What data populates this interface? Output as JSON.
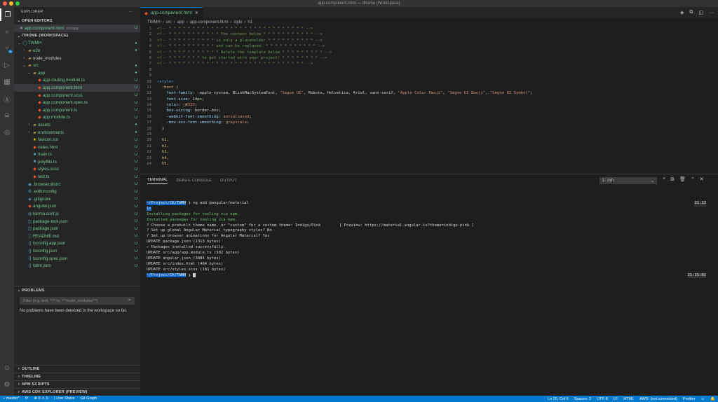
{
  "window": {
    "title": "app.component.html — ithome (Workspace)"
  },
  "activity_bar": {
    "items": [
      {
        "icon": "files-icon",
        "glyph": "❐"
      },
      {
        "icon": "search-icon",
        "glyph": "⌕"
      },
      {
        "icon": "source-control-icon",
        "glyph": "⑂",
        "badge": "31"
      },
      {
        "icon": "run-debug-icon",
        "glyph": "▷"
      },
      {
        "icon": "extensions-icon",
        "glyph": "▦"
      },
      {
        "icon": "angular-icon",
        "glyph": "Ⓐ"
      },
      {
        "icon": "aws-icon",
        "glyph": "≋"
      },
      {
        "icon": "remote-explorer-icon",
        "glyph": "◎"
      }
    ],
    "bottom": [
      {
        "icon": "accounts-icon",
        "glyph": "☺"
      },
      {
        "icon": "settings-gear-icon",
        "glyph": "⚙"
      }
    ]
  },
  "sidebar": {
    "title": "EXPLORER",
    "more": "···",
    "open_editors": {
      "label": "OPEN EDITORS",
      "items": [
        {
          "close": "✕",
          "name": "app.component.html",
          "path": "src/app",
          "decoration": "U"
        }
      ]
    },
    "workspace": {
      "label": "ITHOME (WORKSPACE)",
      "tree": [
        {
          "depth": 0,
          "twist": "⌄",
          "icon": "◯",
          "color": "#73c991",
          "name": "TWMH",
          "decoration": "●"
        },
        {
          "depth": 1,
          "twist": "›",
          "icon": "▰",
          "color": "#73c991",
          "name": "e2e",
          "decoration": "●"
        },
        {
          "depth": 1,
          "twist": "›",
          "icon": "▰",
          "color": "#cccccc",
          "name": "node_modules",
          "decoration": ""
        },
        {
          "depth": 1,
          "twist": "⌄",
          "icon": "▰",
          "color": "#73c991",
          "name": "src",
          "decoration": "●"
        },
        {
          "depth": 2,
          "twist": "⌄",
          "icon": "▰",
          "color": "#73c991",
          "name": "app",
          "decoration": "●"
        },
        {
          "depth": 3,
          "twist": "",
          "icon": "◆",
          "color": "#73c991",
          "name": "app-routing.module.ts",
          "decoration": "U"
        },
        {
          "depth": 3,
          "twist": "",
          "icon": "◆",
          "color": "#73c991",
          "name": "app.component.html",
          "decoration": "U",
          "selected": true
        },
        {
          "depth": 3,
          "twist": "",
          "icon": "◆",
          "color": "#73c991",
          "name": "app.component.scss",
          "decoration": "U"
        },
        {
          "depth": 3,
          "twist": "",
          "icon": "◆",
          "color": "#73c991",
          "name": "app.component.spec.ts",
          "decoration": "U"
        },
        {
          "depth": 3,
          "twist": "",
          "icon": "◆",
          "color": "#73c991",
          "name": "app.component.ts",
          "decoration": "U"
        },
        {
          "depth": 3,
          "twist": "",
          "icon": "◆",
          "color": "#73c991",
          "name": "app.module.ts",
          "decoration": "U"
        },
        {
          "depth": 2,
          "twist": "›",
          "icon": "▰",
          "color": "#73c991",
          "name": "assets",
          "decoration": "●"
        },
        {
          "depth": 2,
          "twist": "›",
          "icon": "▰",
          "color": "#73c991",
          "name": "environments",
          "decoration": "●"
        },
        {
          "depth": 2,
          "twist": "",
          "icon": "★",
          "color": "#73c991",
          "name": "favicon.ico",
          "decoration": "U"
        },
        {
          "depth": 2,
          "twist": "",
          "icon": "◆",
          "color": "#73c991",
          "name": "index.html",
          "decoration": "U"
        },
        {
          "depth": 2,
          "twist": "",
          "icon": "■",
          "color": "#73c991",
          "name": "main.ts",
          "decoration": "U"
        },
        {
          "depth": 2,
          "twist": "",
          "icon": "■",
          "color": "#73c991",
          "name": "polyfills.ts",
          "decoration": "U"
        },
        {
          "depth": 2,
          "twist": "",
          "icon": "◆",
          "color": "#73c991",
          "name": "styles.scss",
          "decoration": "U"
        },
        {
          "depth": 2,
          "twist": "",
          "icon": "◆",
          "color": "#73c991",
          "name": "test.ts",
          "decoration": "U"
        },
        {
          "depth": 1,
          "twist": "",
          "icon": "◉",
          "color": "#73c991",
          "name": ".browserslistrc",
          "decoration": "U"
        },
        {
          "depth": 1,
          "twist": "",
          "icon": "⚙",
          "color": "#73c991",
          "name": ".editorconfig",
          "decoration": "U"
        },
        {
          "depth": 1,
          "twist": "",
          "icon": "◈",
          "color": "#73c991",
          "name": ".gitignore",
          "decoration": "U"
        },
        {
          "depth": 1,
          "twist": "",
          "icon": "◆",
          "color": "#73c991",
          "name": "angular.json",
          "decoration": "U"
        },
        {
          "depth": 1,
          "twist": "",
          "icon": "◍",
          "color": "#73c991",
          "name": "karma.conf.js",
          "decoration": "U"
        },
        {
          "depth": 1,
          "twist": "",
          "icon": "◫",
          "color": "#73c991",
          "name": "package-lock.json",
          "decoration": "U"
        },
        {
          "depth": 1,
          "twist": "",
          "icon": "◫",
          "color": "#73c991",
          "name": "package.json",
          "decoration": "U"
        },
        {
          "depth": 1,
          "twist": "",
          "icon": "ⓘ",
          "color": "#73c991",
          "name": "README.md",
          "decoration": "U"
        },
        {
          "depth": 1,
          "twist": "",
          "icon": "{}",
          "color": "#73c991",
          "name": "tsconfig.app.json",
          "decoration": "U"
        },
        {
          "depth": 1,
          "twist": "",
          "icon": "{}",
          "color": "#73c991",
          "name": "tsconfig.json",
          "decoration": "U"
        },
        {
          "depth": 1,
          "twist": "",
          "icon": "{}",
          "color": "#73c991",
          "name": "tsconfig.spec.json",
          "decoration": "U"
        },
        {
          "depth": 1,
          "twist": "",
          "icon": "{}",
          "color": "#73c991",
          "name": "tslint.json",
          "decoration": "U"
        }
      ]
    },
    "problems": {
      "label": "PROBLEMS",
      "filter_placeholder": "Filter (e.g. text, **/*.ts, !**/node_modules/**)",
      "message": "No problems have been detected in the workspace so far."
    },
    "bottom_sections": [
      "OUTLINE",
      "TIMELINE",
      "NPM SCRIPTS",
      "AWS CDK EXPLORER (PREVIEW)"
    ]
  },
  "editor": {
    "tab": {
      "label": "app.component.html",
      "close": "✕"
    },
    "breadcrumb": [
      "TWMH",
      "src",
      "app",
      "app.component.html",
      "style",
      "h1"
    ],
    "lines": [
      {
        "n": "1",
        "parts": [
          {
            "t": "<!-- * * * * * * * * * * * * * * * * * * * * * * * * * * * * * -->",
            "c": "#6a9955"
          }
        ]
      },
      {
        "n": "2",
        "parts": [
          {
            "t": "<!-- * * * * * * * * * * * The content below * * * * * * * * * * * -->",
            "c": "#6a9955"
          }
        ]
      },
      {
        "n": "3",
        "parts": [
          {
            "t": "<!-- * * * * * * * * * * is only a placeholder * * * * * * * * * * -->",
            "c": "#6a9955"
          }
        ]
      },
      {
        "n": "4",
        "parts": [
          {
            "t": "<!-- * * * * * * * * * * and can be replaced. * * * * * * * * * * * -->",
            "c": "#6a9955"
          }
        ]
      },
      {
        "n": "5",
        "parts": [
          {
            "t": "<!-- * * * * * * * * * * * Delete the template below * * * * * * * * * -->",
            "c": "#6a9955"
          }
        ]
      },
      {
        "n": "6",
        "parts": [
          {
            "t": "<!-- * * * * * * * to get started with your project! * * * * * * * * -->",
            "c": "#6a9955"
          }
        ]
      },
      {
        "n": "7",
        "parts": [
          {
            "t": "<!-- * * * * * * * * * * * * * * * * * * * * * * * * * * * * * -->",
            "c": "#6a9955"
          }
        ]
      },
      {
        "n": "8",
        "parts": []
      },
      {
        "n": "9",
        "parts": []
      },
      {
        "n": "10",
        "parts": [
          {
            "t": "<style>",
            "c": "#569cd6"
          }
        ]
      },
      {
        "n": "11",
        "parts": [
          {
            "t": "  :host {",
            "c": "#d7ba7d"
          }
        ]
      },
      {
        "n": "12",
        "parts": [
          {
            "t": "    font-family",
            "c": "#9cdcfe"
          },
          {
            "t": ": -apple-system, BlinkMacSystemFont, ",
            "c": "#d4d4d4"
          },
          {
            "t": "\"Segoe UI\"",
            "c": "#ce9178"
          },
          {
            "t": ", Roboto, Helvetica, Arial, sans-serif, ",
            "c": "#d4d4d4"
          },
          {
            "t": "\"Apple Color Emoji\"",
            "c": "#ce9178"
          },
          {
            "t": ", ",
            "c": "#d4d4d4"
          },
          {
            "t": "\"Segoe UI Emoji\"",
            "c": "#ce9178"
          },
          {
            "t": ", ",
            "c": "#d4d4d4"
          },
          {
            "t": "\"Segoe UI Symbol\"",
            "c": "#ce9178"
          },
          {
            "t": ";",
            "c": "#d4d4d4"
          }
        ]
      },
      {
        "n": "13",
        "parts": [
          {
            "t": "    font-size",
            "c": "#9cdcfe"
          },
          {
            "t": ": ",
            "c": "#d4d4d4"
          },
          {
            "t": "14px",
            "c": "#b5cea8"
          },
          {
            "t": ";",
            "c": "#d4d4d4"
          }
        ]
      },
      {
        "n": "14",
        "parts": [
          {
            "t": "    color",
            "c": "#9cdcfe"
          },
          {
            "t": ": ",
            "c": "#d4d4d4"
          },
          {
            "t": "□#333",
            "c": "#ce9178"
          },
          {
            "t": ";",
            "c": "#d4d4d4"
          }
        ]
      },
      {
        "n": "15",
        "parts": [
          {
            "t": "    box-sizing",
            "c": "#9cdcfe"
          },
          {
            "t": ": border-box;",
            "c": "#d4d4d4"
          }
        ]
      },
      {
        "n": "16",
        "parts": [
          {
            "t": "    -webkit-font-smoothing",
            "c": "#9cdcfe"
          },
          {
            "t": ": ",
            "c": "#d4d4d4"
          },
          {
            "t": "antialiased",
            "c": "#ce9178"
          },
          {
            "t": ";",
            "c": "#d4d4d4"
          }
        ]
      },
      {
        "n": "17",
        "parts": [
          {
            "t": "    -moz-osx-font-smoothing",
            "c": "#9cdcfe"
          },
          {
            "t": ": ",
            "c": "#d4d4d4"
          },
          {
            "t": "grayscale",
            "c": "#ce9178"
          },
          {
            "t": ";",
            "c": "#d4d4d4"
          }
        ]
      },
      {
        "n": "18",
        "parts": [
          {
            "t": "  }",
            "c": "#d4d4d4"
          }
        ]
      },
      {
        "n": "19",
        "parts": []
      },
      {
        "n": "20",
        "parts": [
          {
            "t": "  h1,",
            "c": "#d7ba7d"
          }
        ]
      },
      {
        "n": "21",
        "parts": [
          {
            "t": "  h2,",
            "c": "#d7ba7d"
          }
        ]
      },
      {
        "n": "22",
        "parts": [
          {
            "t": "  h3,",
            "c": "#d7ba7d"
          }
        ]
      },
      {
        "n": "23",
        "parts": [
          {
            "t": "  h4,",
            "c": "#d7ba7d"
          }
        ]
      },
      {
        "n": "24",
        "parts": [
          {
            "t": "  h5,",
            "c": "#d7ba7d"
          }
        ]
      }
    ]
  },
  "panel": {
    "tabs": [
      {
        "label": "TERMINAL",
        "active": true
      },
      {
        "label": "DEBUG CONSOLE"
      },
      {
        "label": "OUTPUT"
      }
    ],
    "terminal_select": "1: zsh",
    "actions": [
      "+",
      "⊞",
      "🗑",
      "⌃",
      "✕"
    ],
    "terminal": [
      {
        "prompt": "~/Project/CK/TWMH",
        "rest": " ❯ ng add @angular/material",
        "time": "21:13",
        "c": "#d4d4d4"
      },
      {
        "prompt": "1s",
        "rest": "",
        "c": "#d4d4d4"
      },
      {
        "text": "Installing packages for tooling via npm.",
        "c": "#6bc46d"
      },
      {
        "text": "Installed packages for tooling via npm.",
        "c": "#6bc46d"
      },
      {
        "text": "? Choose a prebuilt theme name, or \"custom\" for a custom theme: Indigo/Pink        [ Preview: https://material.angular.io?theme=indigo-pink ]",
        "c": "#d4d4d4"
      },
      {
        "text": "? Set up global Angular Material typography styles? No",
        "c": "#d4d4d4"
      },
      {
        "text": "? Set up browser animations for Angular Material? Yes",
        "c": "#d4d4d4"
      },
      {
        "text": "UPDATE package.json (1313 bytes)",
        "c": "#d4d4d4"
      },
      {
        "text": "✓ Packages installed successfully.",
        "c": "#d4d4d4"
      },
      {
        "text": "UPDATE src/app/app.module.ts (502 bytes)",
        "c": "#d4d4d4"
      },
      {
        "text": "UPDATE angular.json (3884 bytes)",
        "c": "#d4d4d4"
      },
      {
        "text": "UPDATE src/index.html (484 bytes)",
        "c": "#d4d4d4"
      },
      {
        "text": "UPDATE src/styles.scss (181 bytes)",
        "c": "#d4d4d4"
      },
      {
        "prompt": "~/Project/CK/TWMH",
        "rest": " ❯ ",
        "time": "21:15:02",
        "cursor": true,
        "c": "#d4d4d4"
      }
    ]
  },
  "status_bar": {
    "left": [
      "⑂ master*",
      "⟳",
      "⊗ 0  ⚠ 0",
      "⟟ Live Share",
      "Git Graph"
    ],
    "right": [
      "Ln 20, Col 6",
      "Spaces: 2",
      "UTF-8",
      "LF",
      "HTML",
      "AWS: (not connected)",
      "Prettier",
      "☺",
      "🔔"
    ]
  },
  "colors": {
    "accent": "#007acc",
    "untracked": "#73c991"
  }
}
